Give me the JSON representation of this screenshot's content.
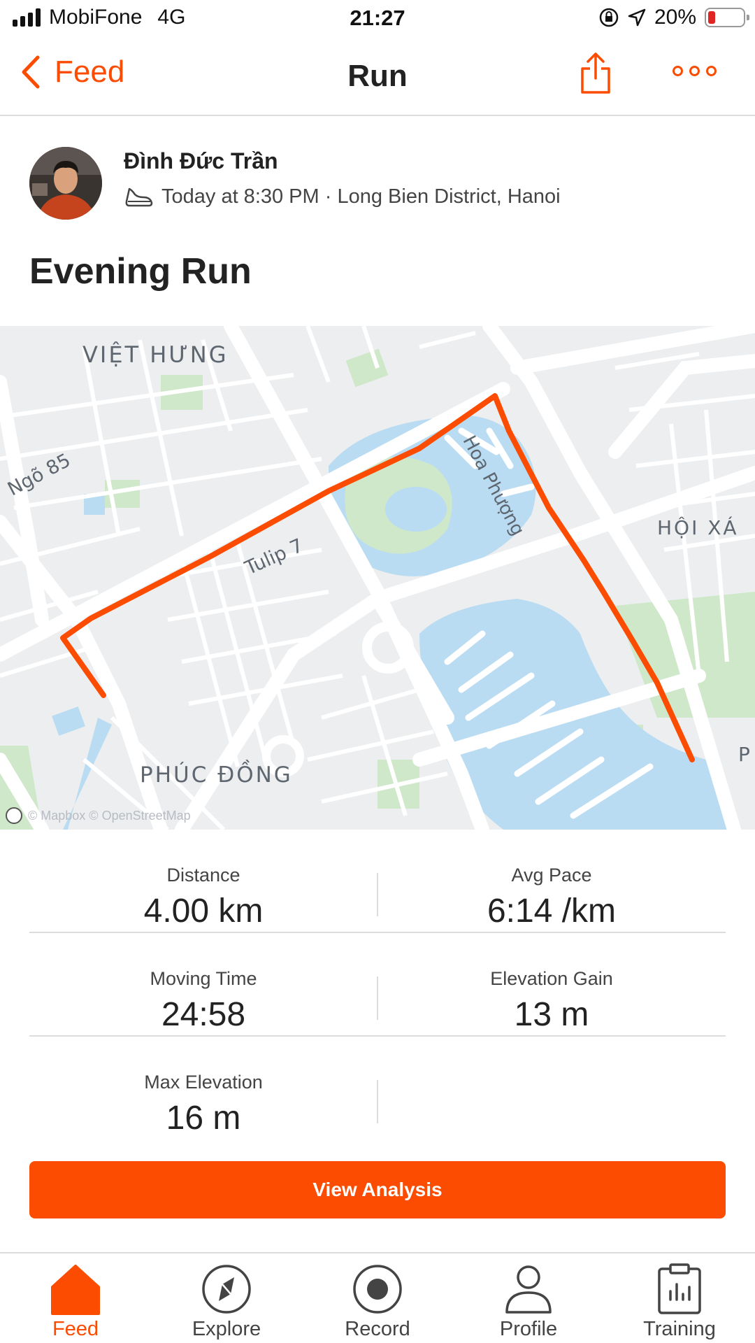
{
  "status_bar": {
    "carrier": "MobiFone",
    "network": "4G",
    "time": "21:27",
    "battery": "20%",
    "battery_level": 0.2,
    "icons": [
      "signal-icon",
      "orientation-lock-icon",
      "location-arrow-icon",
      "battery-icon"
    ]
  },
  "nav": {
    "back_label": "Feed",
    "title": "Run",
    "icons": [
      "chevron-left-icon",
      "share-icon",
      "more-icon"
    ]
  },
  "athlete": {
    "name": "Đình Đức Trần",
    "meta": "Today at 8:30 PM · Long Bien District, Hanoi",
    "icon": "shoe-icon"
  },
  "activity": {
    "title": "Evening Run"
  },
  "map": {
    "labels": {
      "viet_hung": "VIỆT HƯNG",
      "ngo_85": "Ngõ 85",
      "hoa_phuong": "Hoa Phượng",
      "hoi_xa": "HỘI XÁ",
      "tulip_7": "Tulip 7",
      "phuc_dong": "PHÚC ĐỒNG",
      "edge_p": "P"
    },
    "attribution": "© Mapbox © OpenStreetMap",
    "route_color": "#fc4c02",
    "water_color": "#b9dcf2",
    "park_color": "#cfe8c9"
  },
  "stats": {
    "distance": {
      "label": "Distance",
      "value": "4.00 km"
    },
    "avg_pace": {
      "label": "Avg Pace",
      "value": "6:14 /km"
    },
    "moving_time": {
      "label": "Moving Time",
      "value": "24:58"
    },
    "elevation_gain": {
      "label": "Elevation Gain",
      "value": "13 m"
    },
    "max_elevation": {
      "label": "Max Elevation",
      "value": "16 m"
    }
  },
  "cta": {
    "label": "View Analysis"
  },
  "tabs": [
    {
      "label": "Feed",
      "icon": "home-icon",
      "active": true
    },
    {
      "label": "Explore",
      "icon": "compass-icon",
      "active": false
    },
    {
      "label": "Record",
      "icon": "record-icon",
      "active": false
    },
    {
      "label": "Profile",
      "icon": "profile-icon",
      "active": false
    },
    {
      "label": "Training",
      "icon": "training-icon",
      "active": false
    }
  ],
  "colors": {
    "accent": "#fc4c02",
    "text": "#222222",
    "divider": "#dcdcdc"
  }
}
